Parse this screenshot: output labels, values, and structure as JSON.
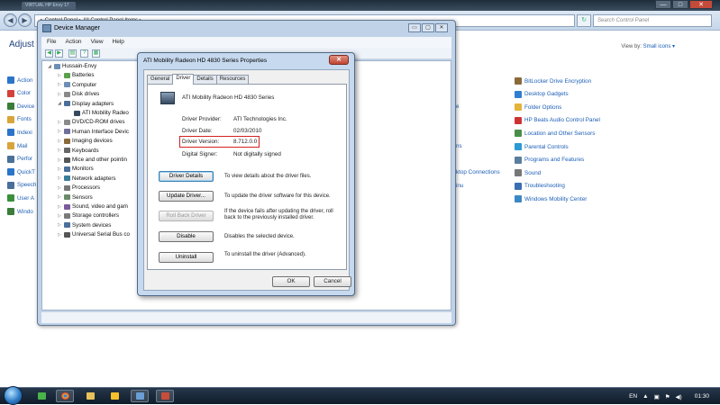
{
  "browser": {
    "tab": "VIRTUAL HP Envy 17 S..."
  },
  "window_controls": {
    "minimize": "—",
    "maximize": "□",
    "close": "✕"
  },
  "cp": {
    "address": "▸ Control Panel ▸ All Control Panel Items ▸",
    "search_placeholder": "Search Control Panel",
    "title": "Adjust y",
    "view_by_label": "View by:",
    "view_by_value": "Small icons ▾",
    "left_items": [
      "Action",
      "Color",
      "Device",
      "Fonts",
      "Indexi",
      "Mail",
      "Perfor",
      "QuickT",
      "Speech",
      "User A",
      "Windo"
    ],
    "mid_items": [
      "e",
      "ns",
      "ktop Connections",
      "inu"
    ],
    "right_items": [
      "BitLocker Drive Encryption",
      "Desktop Gadgets",
      "Folder Options",
      "HP Beats Audio Control Panel",
      "Location and Other Sensors",
      "Parental Controls",
      "Programs and Features",
      "Sound",
      "Troubleshooting",
      "Windows Mobility Center"
    ],
    "right_colors": [
      "#8a6a3a",
      "#2f7fd1",
      "#e3b33a",
      "#cc3333",
      "#4a8d4a",
      "#2d9ad3",
      "#5a7e9c",
      "#777777",
      "#3a6fb0",
      "#3b88c4"
    ]
  },
  "dm": {
    "title": "Device Manager",
    "menu": [
      "File",
      "Action",
      "View",
      "Help"
    ],
    "tree": [
      {
        "label": "Hussain-Envy",
        "exp": "◢"
      },
      {
        "label": "Batteries",
        "exp": "▷"
      },
      {
        "label": "Computer",
        "exp": "▷"
      },
      {
        "label": "Disk drives",
        "exp": "▷"
      },
      {
        "label": "Display adapters",
        "exp": "◢"
      },
      {
        "label": "ATI Mobility Radeo",
        "exp": ""
      },
      {
        "label": "DVD/CD-ROM drives",
        "exp": "▷"
      },
      {
        "label": "Human Interface Devic",
        "exp": "▷"
      },
      {
        "label": "Imaging devices",
        "exp": "▷"
      },
      {
        "label": "Keyboards",
        "exp": "▷"
      },
      {
        "label": "Mice and other pointin",
        "exp": "▷"
      },
      {
        "label": "Monitors",
        "exp": "▷"
      },
      {
        "label": "Network adapters",
        "exp": "▷"
      },
      {
        "label": "Processors",
        "exp": "▷"
      },
      {
        "label": "Sensors",
        "exp": "▷"
      },
      {
        "label": "Sound, video and gam",
        "exp": "▷"
      },
      {
        "label": "Storage controllers",
        "exp": "▷"
      },
      {
        "label": "System devices",
        "exp": "▷"
      },
      {
        "label": "Universal Serial Bus co",
        "exp": "▷"
      }
    ]
  },
  "props": {
    "title": "ATI Mobility Radeon HD 4830 Series Properties",
    "close": "✕",
    "tabs": [
      "General",
      "Driver",
      "Details",
      "Resources"
    ],
    "device_name": "ATI Mobility Radeon HD 4830 Series",
    "provider_label": "Driver Provider:",
    "provider_value": "ATI Technologies Inc.",
    "date_label": "Driver Date:",
    "date_value": "02/03/2010",
    "version_label": "Driver Version:",
    "version_value": "8.712.0.0",
    "signer_label": "Digital Signer:",
    "signer_value": "Not digitally signed",
    "details_btn": "Driver Details",
    "details_desc": "To view details about the driver files.",
    "update_btn": "Update Driver...",
    "update_desc": "To update the driver software for this device.",
    "rollback_btn": "Roll Back Driver",
    "rollback_desc": "If the device fails after updating the driver, roll back to the previously installed driver.",
    "disable_btn": "Disable",
    "disable_desc": "Disables the selected device.",
    "uninstall_btn": "Uninstall",
    "uninstall_desc": "To uninstall the driver (Advanced).",
    "ok": "OK",
    "cancel": "Cancel"
  },
  "taskbar": {
    "lang": "EN",
    "time": "01:30"
  }
}
